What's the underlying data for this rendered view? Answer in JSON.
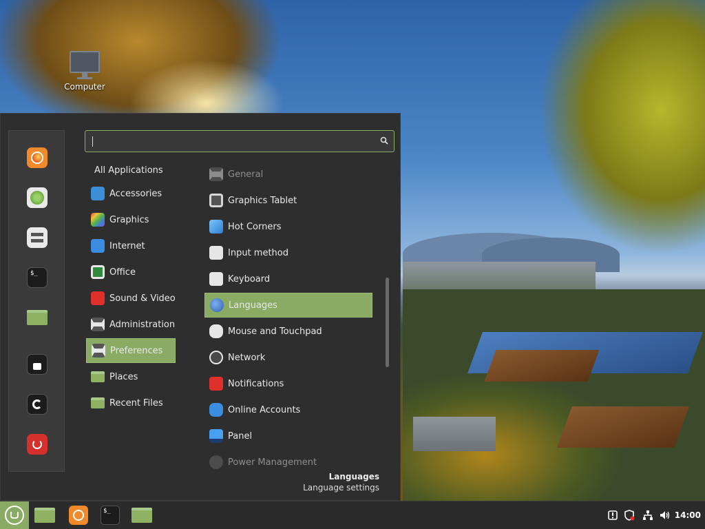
{
  "desktop": {
    "icons": [
      {
        "label": "Computer",
        "icon": "computer-icon"
      }
    ]
  },
  "menu": {
    "search": {
      "value": "",
      "placeholder": "",
      "icon": "search-icon"
    },
    "favorites": [
      {
        "name": "firefox",
        "icon": "firefox-icon"
      },
      {
        "name": "software-manager",
        "icon": "apps-grid-icon"
      },
      {
        "name": "system-settings",
        "icon": "toggles-icon"
      },
      {
        "name": "terminal",
        "icon": "terminal-icon"
      },
      {
        "name": "files",
        "icon": "folder-icon"
      },
      {
        "name": "lock-screen",
        "icon": "lock-icon"
      },
      {
        "name": "logout",
        "icon": "logout-icon"
      },
      {
        "name": "quit",
        "icon": "power-icon"
      }
    ],
    "categories": [
      {
        "label": "All Applications"
      },
      {
        "label": "Accessories",
        "icon": "scissors-icon"
      },
      {
        "label": "Graphics",
        "icon": "palette-icon"
      },
      {
        "label": "Internet",
        "icon": "cloud-icon"
      },
      {
        "label": "Office",
        "icon": "document-icon"
      },
      {
        "label": "Sound & Video",
        "icon": "play-icon"
      },
      {
        "label": "Administration",
        "icon": "toggles-icon"
      },
      {
        "label": "Preferences",
        "icon": "toggles-icon",
        "selected": true
      },
      {
        "label": "Places",
        "icon": "folder-icon"
      },
      {
        "label": "Recent Files",
        "icon": "recent-folder-icon"
      }
    ],
    "apps": [
      {
        "label": "General",
        "icon": "general-icon",
        "dimmed": true
      },
      {
        "label": "Graphics Tablet",
        "icon": "tablet-icon"
      },
      {
        "label": "Hot Corners",
        "icon": "hot-corners-icon"
      },
      {
        "label": "Input method",
        "icon": "input-method-icon"
      },
      {
        "label": "Keyboard",
        "icon": "keyboard-icon"
      },
      {
        "label": "Languages",
        "icon": "globe-icon",
        "selected": true
      },
      {
        "label": "Mouse and Touchpad",
        "icon": "mouse-icon"
      },
      {
        "label": "Network",
        "icon": "wifi-icon"
      },
      {
        "label": "Notifications",
        "icon": "bell-icon"
      },
      {
        "label": "Online Accounts",
        "icon": "cloud-icon"
      },
      {
        "label": "Panel",
        "icon": "panel-icon"
      },
      {
        "label": "Power Management",
        "icon": "power-management-icon",
        "dimmed": true
      }
    ],
    "description": {
      "title": "Languages",
      "text": "Language settings"
    }
  },
  "panel": {
    "taskbar": [
      {
        "name": "files",
        "icon": "folder-icon"
      },
      {
        "name": "firefox",
        "icon": "firefox-icon"
      },
      {
        "name": "terminal",
        "icon": "terminal-icon"
      },
      {
        "name": "files-2",
        "icon": "folder-icon"
      }
    ],
    "tray": [
      "update-manager-icon",
      "shield-icon",
      "network-icon",
      "volume-icon"
    ],
    "clock": "14:00"
  },
  "colors": {
    "accent": "#8aab64",
    "menu_bg": "#2e2e2e",
    "panel_bg": "#2b2b2b"
  }
}
